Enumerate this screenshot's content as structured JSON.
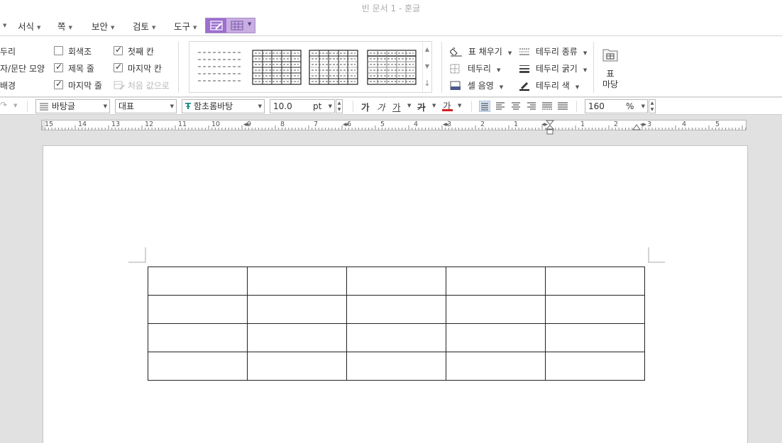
{
  "window": {
    "title": "빈 문서 1 - 훈글"
  },
  "menu": {
    "items": [
      "서식",
      "쪽",
      "보안",
      "검토",
      "도구"
    ]
  },
  "ribbon": {
    "border_group": [
      "두리",
      "자/문단 모양",
      "배경"
    ],
    "table_style_options": [
      {
        "label": "회색조",
        "checked": false
      },
      {
        "label": "제목 줄",
        "checked": true
      },
      {
        "label": "마지막 줄",
        "checked": true
      },
      {
        "label": "첫째 칸",
        "checked": true
      },
      {
        "label": "마지막 칸",
        "checked": true
      }
    ],
    "reset_label": "처음 값으로",
    "fill_label": "표 채우기",
    "border_label": "테두리",
    "cell_shade_label": "셀 음영",
    "border_type_label": "테두리 종류",
    "border_thickness_label": "테두리 굵기",
    "border_color_label": "테두리 색",
    "table_yard_label_1": "표",
    "table_yard_label_2": "마당"
  },
  "format_toolbar": {
    "style_name": "바탕글",
    "language": "대표",
    "font_name": "함초롬바탕",
    "font_size": "10.0",
    "font_unit": "pt",
    "bold": "가",
    "italic": "가",
    "underline": "가",
    "strike": "가",
    "color_char": "가",
    "zoom_value": "160",
    "zoom_unit": "%"
  },
  "ruler": {
    "labels": [
      "15",
      "14",
      "13",
      "12",
      "11",
      "10",
      "9",
      "8",
      "7",
      "6",
      "5",
      "4",
      "3",
      "2",
      "1",
      "1",
      "2",
      "3",
      "4",
      "5"
    ]
  },
  "document": {
    "table": {
      "rows": 4,
      "cols": 5
    }
  },
  "colors": {
    "accent": "#9c6fd0",
    "accent_light": "#c8aee2",
    "font_color_bar": "#d62020",
    "page_bg": "#ffffff",
    "workspace_bg": "#e1e1e1"
  }
}
